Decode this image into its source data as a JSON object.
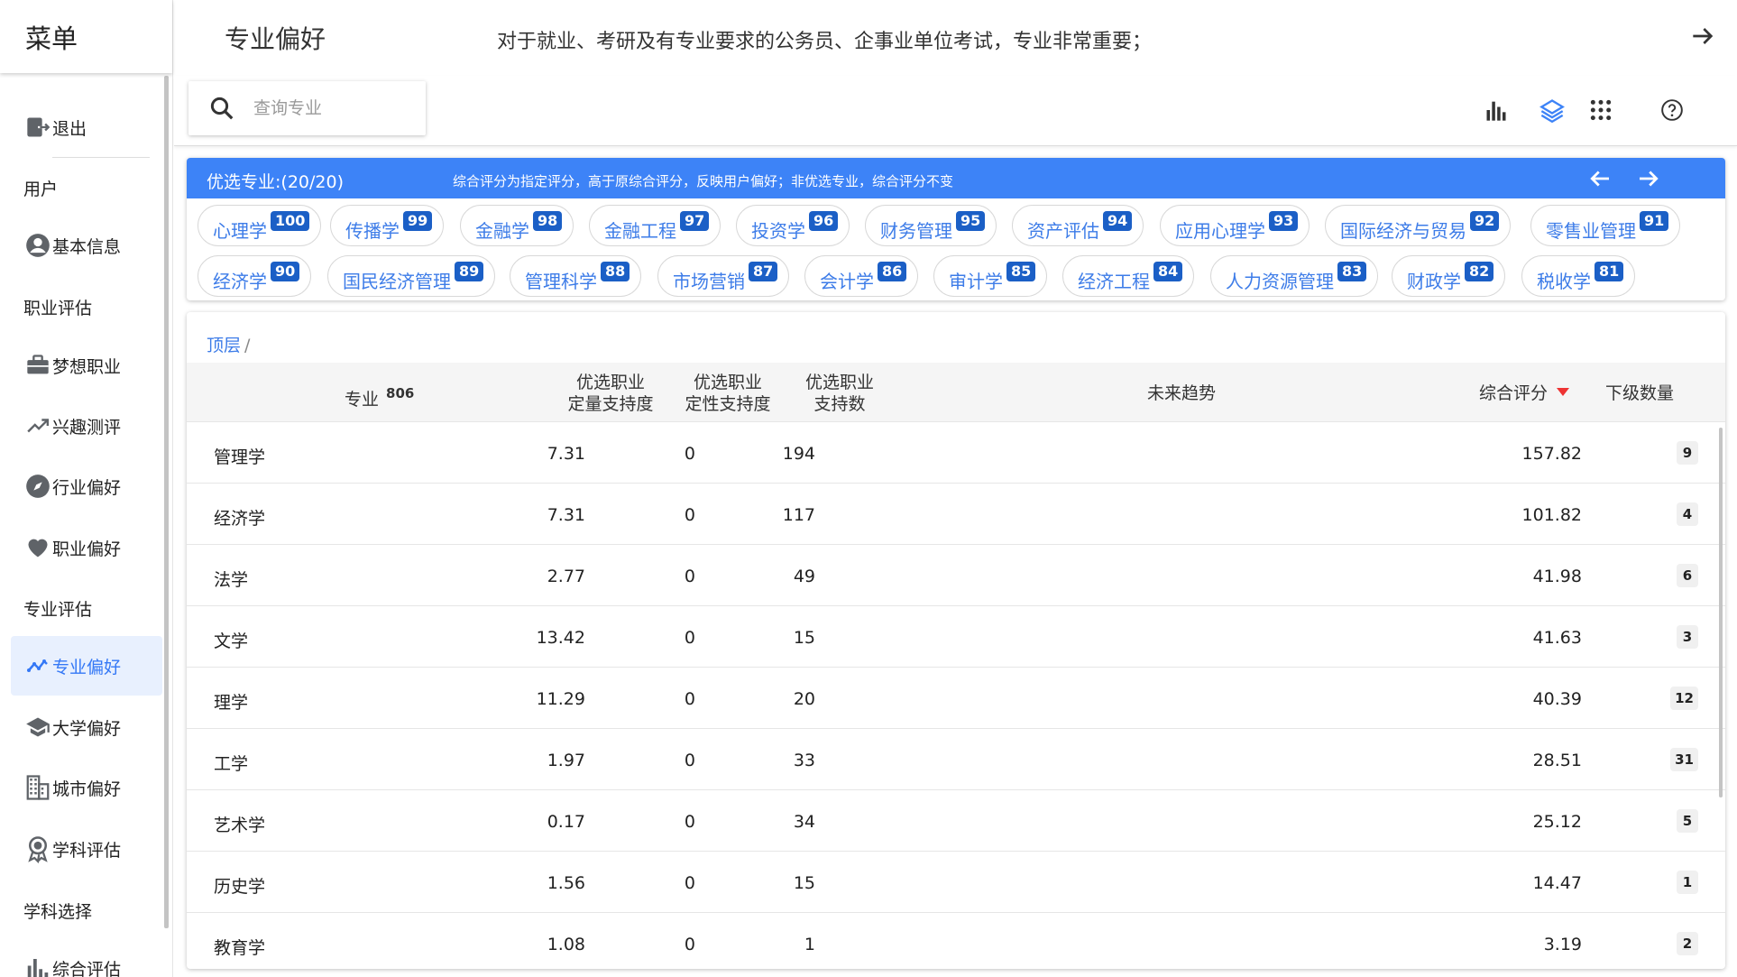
{
  "sidebar": {
    "title": "菜单",
    "items": [
      {
        "label": "退出",
        "icon": "logout-icon"
      },
      {
        "label": "用户",
        "group": true
      },
      {
        "label": "基本信息",
        "icon": "account-circle-icon"
      },
      {
        "label": "职业评估",
        "group": true
      },
      {
        "label": "梦想职业",
        "icon": "briefcase-icon"
      },
      {
        "label": "兴趣测评",
        "icon": "trending-up-icon"
      },
      {
        "label": "行业偏好",
        "icon": "compass-icon"
      },
      {
        "label": "职业偏好",
        "icon": "heart-icon"
      },
      {
        "label": "专业评估",
        "group": true
      },
      {
        "label": "专业偏好",
        "icon": "timeline-icon",
        "active": true
      },
      {
        "label": "大学偏好",
        "icon": "school-icon"
      },
      {
        "label": "城市偏好",
        "icon": "city-icon"
      },
      {
        "label": "学科评估",
        "icon": "award-icon"
      },
      {
        "label": "学科选择",
        "group": true
      },
      {
        "label": "综合评估",
        "icon": "bar-chart-icon"
      }
    ]
  },
  "header": {
    "title": "专业偏好",
    "description": "对于就业、考研及有专业要求的公务员、企事业单位考试，专业非常重要；"
  },
  "toolbar": {
    "search_placeholder": "查询专业"
  },
  "selected": {
    "title": "优选专业:(20/20)",
    "note": "综合评分为指定评分，高于原综合评分，反映用户偏好；非优选专业，综合评分不变",
    "chips": [
      {
        "label": "心理学",
        "score": "100"
      },
      {
        "label": "传播学",
        "score": "99"
      },
      {
        "label": "金融学",
        "score": "98"
      },
      {
        "label": "金融工程",
        "score": "97"
      },
      {
        "label": "投资学",
        "score": "96"
      },
      {
        "label": "财务管理",
        "score": "95"
      },
      {
        "label": "资产评估",
        "score": "94"
      },
      {
        "label": "应用心理学",
        "score": "93"
      },
      {
        "label": "国际经济与贸易",
        "score": "92"
      },
      {
        "label": "零售业管理",
        "score": "91"
      },
      {
        "label": "经济学",
        "score": "90"
      },
      {
        "label": "国民经济管理",
        "score": "89"
      },
      {
        "label": "管理科学",
        "score": "88"
      },
      {
        "label": "市场营销",
        "score": "87"
      },
      {
        "label": "会计学",
        "score": "86"
      },
      {
        "label": "审计学",
        "score": "85"
      },
      {
        "label": "经济工程",
        "score": "84"
      },
      {
        "label": "人力资源管理",
        "score": "83"
      },
      {
        "label": "财政学",
        "score": "82"
      },
      {
        "label": "税收学",
        "score": "81"
      }
    ]
  },
  "table": {
    "breadcrumb_root": "顶层",
    "breadcrumb_sep": "/",
    "headers": {
      "major": "专业",
      "major_count": "806",
      "quant_line1": "优选职业",
      "quant_line2": "定量支持度",
      "qual_line1": "优选职业",
      "qual_line2": "定性支持度",
      "support_line1": "优选职业",
      "support_line2": "支持数",
      "trend": "未来趋势",
      "score": "综合评分",
      "children": "下级数量"
    },
    "rows": [
      {
        "name": "管理学",
        "quant": "7.31",
        "qual": "0",
        "support": "194",
        "score": "157.82",
        "children": "9"
      },
      {
        "name": "经济学",
        "quant": "7.31",
        "qual": "0",
        "support": "117",
        "score": "101.82",
        "children": "4"
      },
      {
        "name": "法学",
        "quant": "2.77",
        "qual": "0",
        "support": "49",
        "score": "41.98",
        "children": "6"
      },
      {
        "name": "文学",
        "quant": "13.42",
        "qual": "0",
        "support": "15",
        "score": "41.63",
        "children": "3"
      },
      {
        "name": "理学",
        "quant": "11.29",
        "qual": "0",
        "support": "20",
        "score": "40.39",
        "children": "12"
      },
      {
        "name": "工学",
        "quant": "1.97",
        "qual": "0",
        "support": "33",
        "score": "28.51",
        "children": "31"
      },
      {
        "name": "艺术学",
        "quant": "0.17",
        "qual": "0",
        "support": "34",
        "score": "25.12",
        "children": "5"
      },
      {
        "name": "历史学",
        "quant": "1.56",
        "qual": "0",
        "support": "15",
        "score": "14.47",
        "children": "1"
      },
      {
        "name": "教育学",
        "quant": "1.08",
        "qual": "0",
        "support": "1",
        "score": "3.19",
        "children": "2"
      }
    ]
  },
  "colors": {
    "accent": "#3d83f7",
    "badge": "#1b5fc6",
    "sort_arrow": "#e33333"
  }
}
